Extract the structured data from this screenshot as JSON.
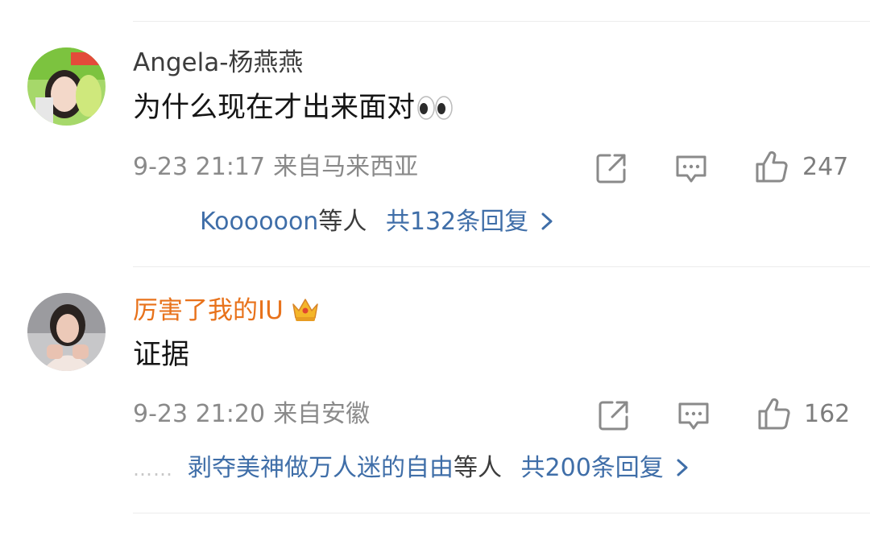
{
  "comments": [
    {
      "username": "Angela-杨燕燕",
      "text": "为什么现在才出来面对",
      "time": "9-23 21:17",
      "location": "来自马来西亚",
      "likes": "247",
      "reply_names": "Koooooon",
      "reply_suffix": "等人",
      "reply_count": "共132条回复",
      "reply_prefix": ""
    },
    {
      "username": "厉害了我的IU",
      "text": "证据",
      "time": "9-23 21:20",
      "location": "来自安徽",
      "likes": "162",
      "reply_names": "剥夺美神做万人迷的自由",
      "reply_suffix": "等人",
      "reply_count": "共200条回复",
      "reply_prefix": "……"
    }
  ],
  "icons": [
    "share-icon",
    "comment-icon",
    "like-icon",
    "chevron-right-icon",
    "crown-icon",
    "eyes-emoji"
  ],
  "colors": {
    "link": "#3f6ea8",
    "vip_name": "#e8721b",
    "meta": "#8a8a8a"
  }
}
